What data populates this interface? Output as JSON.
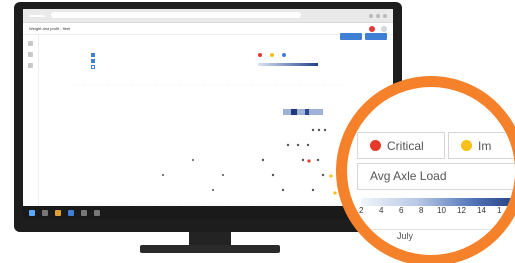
{
  "screen": {
    "title": "Weight and profit - fleet",
    "legend": {
      "colors": [
        "#e53a2b",
        "#f7c018",
        "#3f7fd6"
      ]
    }
  },
  "callout": {
    "chips": [
      {
        "label": "Critical",
        "color": "#e53a2b"
      },
      {
        "label": "Im",
        "color": "#f7c018"
      }
    ],
    "field": "Avg Axle Load",
    "scale": {
      "ticks": [
        "2",
        "4",
        "6",
        "8",
        "10",
        "12",
        "14",
        "1"
      ]
    },
    "month": "July"
  },
  "colors": {
    "accent": "#f5822a",
    "primary_button": "#3f7fd6",
    "critical": "#e53a2b",
    "important": "#f7c018"
  }
}
